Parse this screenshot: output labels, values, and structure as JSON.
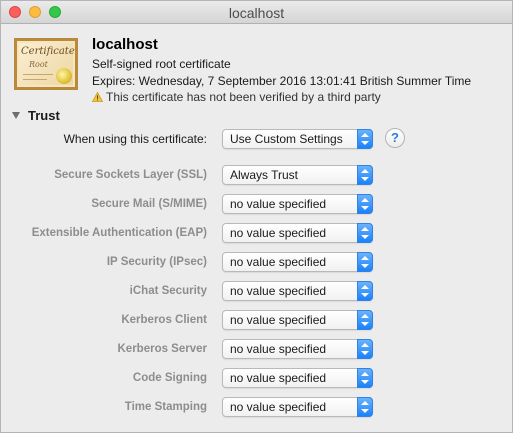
{
  "window": {
    "title": "localhost"
  },
  "certificate": {
    "icon_name": "certificate-icon",
    "icon_text": "Certificate",
    "icon_subtext": "Root",
    "name": "localhost",
    "subtitle": "Self-signed root certificate",
    "expires": "Expires: Wednesday, 7 September 2016 13:01:41 British Summer Time",
    "warning": "This certificate has not been verified by a third party"
  },
  "trust": {
    "section_label": "Trust",
    "when_using_label": "When using this certificate:",
    "when_using_value": "Use Custom Settings",
    "help_label": "?",
    "rows": [
      {
        "label": "Secure Sockets Layer (SSL)",
        "value": "Always Trust"
      },
      {
        "label": "Secure Mail (S/MIME)",
        "value": "no value specified"
      },
      {
        "label": "Extensible Authentication (EAP)",
        "value": "no value specified"
      },
      {
        "label": "IP Security (IPsec)",
        "value": "no value specified"
      },
      {
        "label": "iChat Security",
        "value": "no value specified"
      },
      {
        "label": "Kerberos Client",
        "value": "no value specified"
      },
      {
        "label": "Kerberos Server",
        "value": "no value specified"
      },
      {
        "label": "Code Signing",
        "value": "no value specified"
      },
      {
        "label": "Time Stamping",
        "value": "no value specified"
      }
    ]
  },
  "colors": {
    "accent": "#1a82fb",
    "label_dim": "#8d8d8d",
    "close": "#fc605c",
    "minimize": "#fdbc40",
    "zoom": "#34c84a"
  }
}
